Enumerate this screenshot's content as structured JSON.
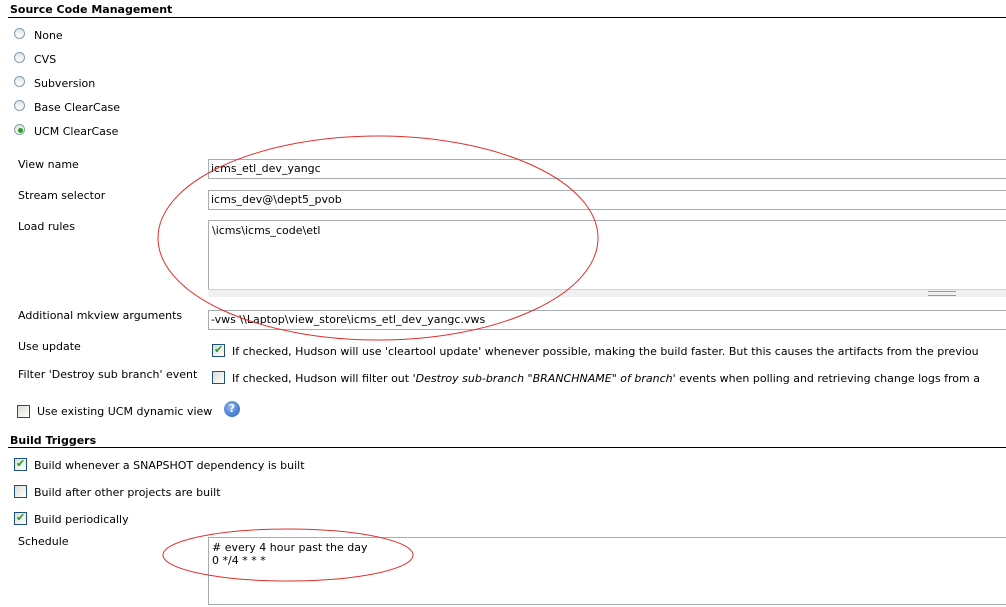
{
  "scm": {
    "title": "Source Code Management",
    "options": [
      "None",
      "CVS",
      "Subversion",
      "Base ClearCase",
      "UCM ClearCase"
    ],
    "selected": "UCM ClearCase",
    "view_name_label": "View name",
    "view_name_value": "icms_etl_dev_yangc",
    "stream_selector_label": "Stream selector",
    "stream_selector_value": "icms_dev@\\dept5_pvob",
    "load_rules_label": "Load rules",
    "load_rules_value": "\\icms\\icms_code\\etl",
    "mkview_label": "Additional mkview arguments",
    "mkview_value": "-vws \\\\Laptop\\view_store\\icms_etl_dev_yangc.vws",
    "use_update_label": "Use update",
    "use_update_checked": true,
    "use_update_desc": "If checked, Hudson will use 'cleartool update' whenever possible, making the build faster. But this causes the artifacts from the previou",
    "filter_label": "Filter 'Destroy sub branch' event",
    "filter_checked": false,
    "filter_desc_pre": "If checked, Hudson will filter out ",
    "filter_desc_em": "'Destroy sub-branch \"BRANCHNAME\" of branch'",
    "filter_desc_post": " events when polling and retrieving change logs from a",
    "dynamic_view_label": "Use existing UCM dynamic view",
    "dynamic_view_checked": false,
    "help_glyph": "?"
  },
  "build_triggers": {
    "title": "Build Triggers",
    "snapshot_label": "Build whenever a SNAPSHOT dependency is built",
    "snapshot_checked": true,
    "after_other_label": "Build after other projects are built",
    "after_other_checked": false,
    "periodically_label": "Build periodically",
    "periodically_checked": true,
    "schedule_label": "Schedule",
    "schedule_value": "# every 4 hour past the day\n0 */4 * * *"
  },
  "annotation_color": "#e0302c"
}
